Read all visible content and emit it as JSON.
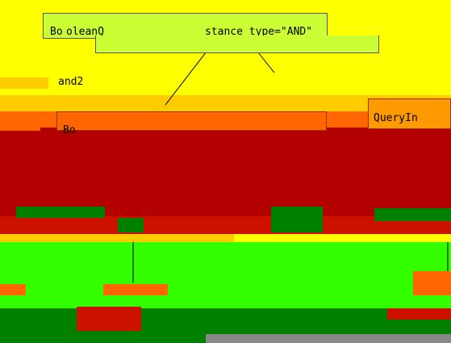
{
  "diagram": {
    "root_node": {
      "prefix": "Bo",
      "class_name": "oleanQ",
      "instance_label": "stance type=\"AND\""
    },
    "child_label": "and2",
    "query_node": {
      "label": "QueryIn"
    },
    "lower_node": {
      "label": "Bo"
    }
  },
  "colors": {
    "background": "#ffff00",
    "root_fill": "#ccff33",
    "orange_band": "#ff6600",
    "dark_red": "#b30000",
    "green_bright": "#33ff00",
    "green_dark": "#008000",
    "gray_bar": "#888888"
  }
}
